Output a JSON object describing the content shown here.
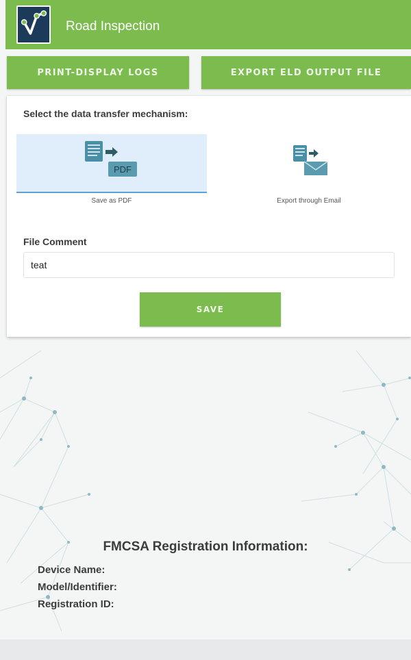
{
  "header": {
    "title": "Road Inspection",
    "logo_icon": "vehicle-tracking-logo",
    "color": "#7cbc4e"
  },
  "tabs": [
    {
      "label": "PRINT-DISPLAY LOGS"
    },
    {
      "label": "EXPORT ELD OUTPUT FILE"
    }
  ],
  "transfer": {
    "heading": "Select the data transfer mechanism:",
    "options": [
      {
        "label": "Save as PDF",
        "icon": "eld-to-pdf-icon",
        "icon_text": "PDF",
        "selected": true
      },
      {
        "label": "Export through Email",
        "icon": "eld-to-email-icon",
        "selected": false
      }
    ]
  },
  "comment": {
    "label": "File Comment",
    "value": "teat",
    "placeholder": ""
  },
  "save_label": "SAVE",
  "registration": {
    "title": "FMCSA Registration Information:",
    "device_name": "Device Name:",
    "model": "Model/Identifier:",
    "registration_id": "Registration ID:"
  },
  "colors": {
    "accent": "#7cbc4e",
    "selected_bg": "#dfeefa",
    "selected_line": "#5ea0d6",
    "icon": "#4a8fa6"
  }
}
